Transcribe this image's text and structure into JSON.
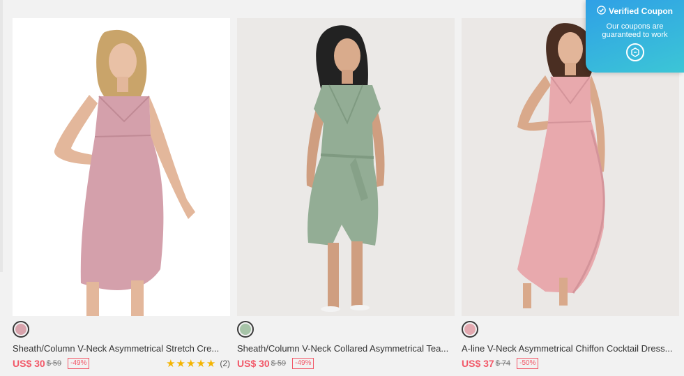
{
  "coupon": {
    "title": "Verified Coupon",
    "subtitle": "Our coupons are guaranteed to work",
    "check_icon": "check-circle-icon",
    "icon": "chat-icon"
  },
  "products": [
    {
      "name": "Sheath/Column V-Neck Asymmetrical Stretch Cre...",
      "price": "US$ 30",
      "original_price": "$ 59",
      "discount": "-49%",
      "swatch_color": "#d8a3ac",
      "image_bg": "#ffffff",
      "dress_color": "#d4a0ab",
      "rating_stars": "★★★★★",
      "rating_value": 5,
      "rating_count": "(2)"
    },
    {
      "name": "Sheath/Column V-Neck Collared Asymmetrical Tea...",
      "price": "US$ 30",
      "original_price": "$ 59",
      "discount": "-49%",
      "swatch_color": "#a7c4a8",
      "image_bg": "#ebe9e7",
      "dress_color": "#93ad95"
    },
    {
      "name": "A-line V-Neck Asymmetrical Chiffon Cocktail Dress...",
      "price": "US$ 37",
      "original_price": "$ 74",
      "discount": "-50%",
      "swatch_color": "#e3a9b0",
      "image_bg": "#ebe8e6",
      "dress_color": "#e8a9ad"
    }
  ]
}
